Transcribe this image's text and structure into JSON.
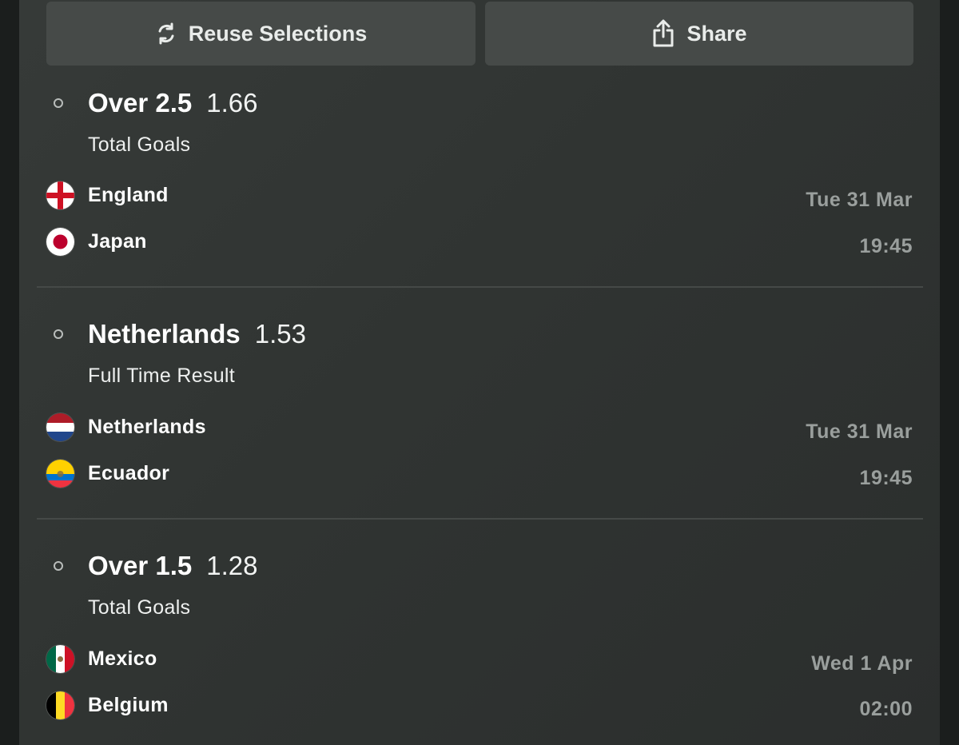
{
  "actions": {
    "reuse_label": "Reuse Selections",
    "share_label": "Share"
  },
  "selections": [
    {
      "name": "Over 2.5",
      "odds": "1.66",
      "market": "Total Goals",
      "home": {
        "team": "England",
        "flag": "england-flag-icon"
      },
      "away": {
        "team": "Japan",
        "flag": "japan-flag-icon"
      },
      "date": "Tue 31 Mar",
      "time": "19:45"
    },
    {
      "name": "Netherlands",
      "odds": "1.53",
      "market": "Full Time Result",
      "home": {
        "team": "Netherlands",
        "flag": "netherlands-flag-icon"
      },
      "away": {
        "team": "Ecuador",
        "flag": "ecuador-flag-icon"
      },
      "date": "Tue 31 Mar",
      "time": "19:45"
    },
    {
      "name": "Over 1.5",
      "odds": "1.28",
      "market": "Total Goals",
      "home": {
        "team": "Mexico",
        "flag": "mexico-flag-icon"
      },
      "away": {
        "team": "Belgium",
        "flag": "belgium-flag-icon"
      },
      "date": "Wed 1 Apr",
      "time": "02:00"
    }
  ],
  "colors": {
    "panel": "#333735",
    "button": "#464a48",
    "muted_text": "#9a9f9d",
    "divider": "#454947"
  }
}
